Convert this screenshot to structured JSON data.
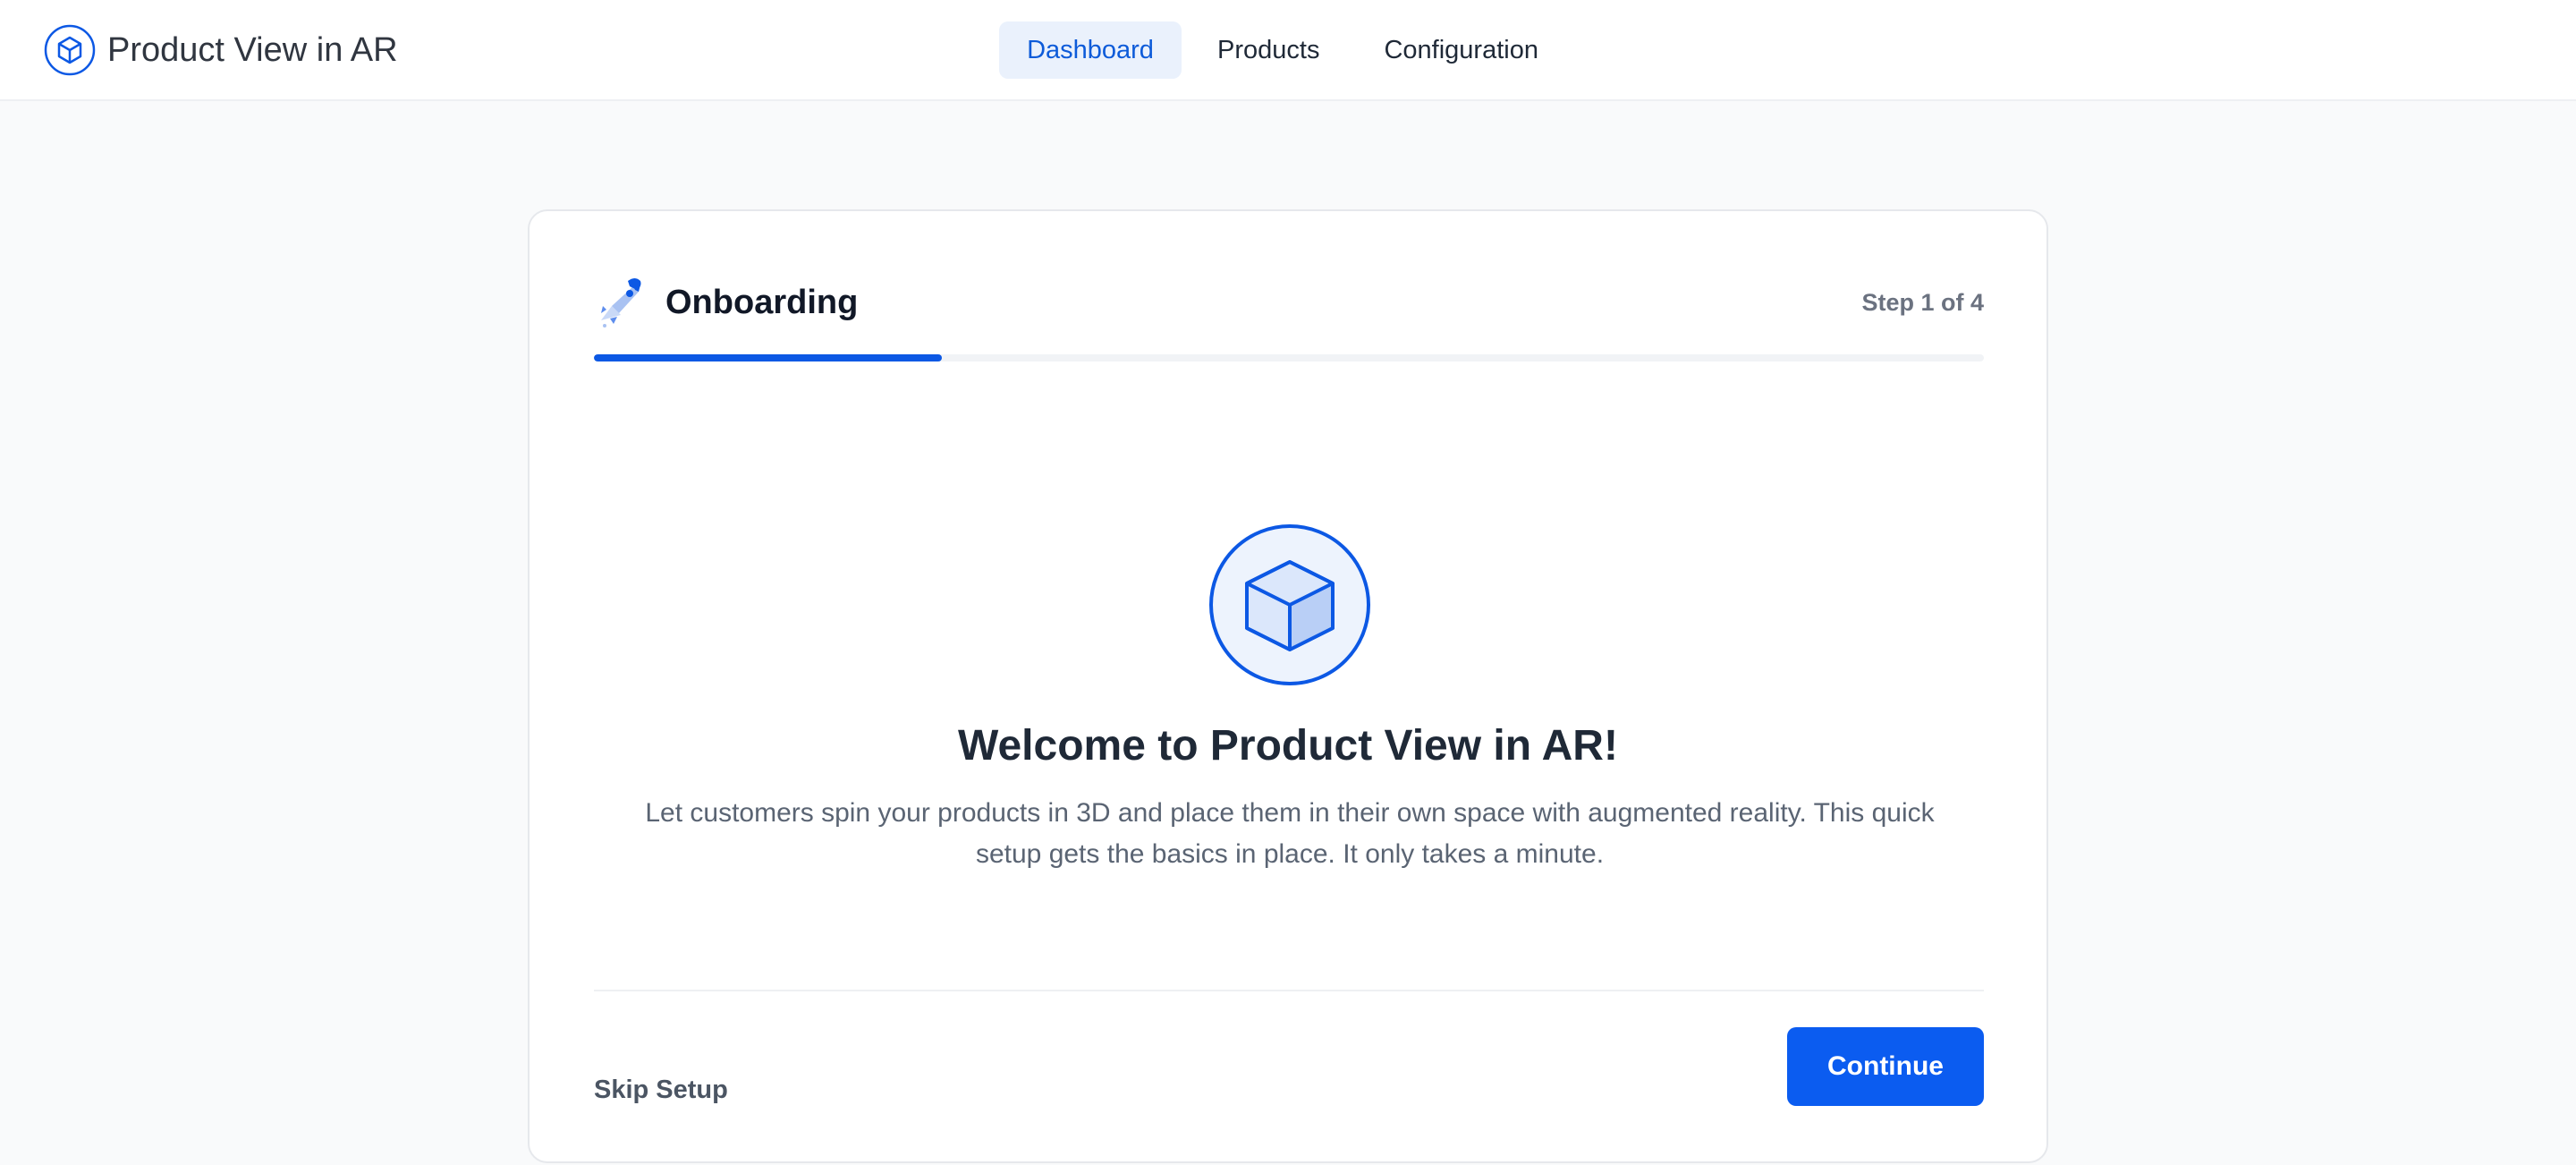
{
  "app": {
    "title": "Product View in AR",
    "logo_icon": "cube-icon"
  },
  "nav": {
    "items": [
      {
        "label": "Dashboard",
        "active": true
      },
      {
        "label": "Products",
        "active": false
      },
      {
        "label": "Configuration",
        "active": false
      }
    ]
  },
  "onboarding": {
    "header_icon": "rocket-icon",
    "title": "Onboarding",
    "step_text": "Step 1 of 4",
    "progress_fraction": 0.25,
    "hero_icon": "cube-icon",
    "welcome_title": "Welcome to Product View in AR!",
    "welcome_description": "Let customers spin your products in 3D and place them in their own space with augmented reality. This quick setup gets the basics in place. It only takes a minute.",
    "skip_label": "Skip Setup",
    "continue_label": "Continue"
  },
  "colors": {
    "accent": "#0b5cf0",
    "nav_active_bg": "#eaf1fc",
    "nav_active_text": "#0d5bd9",
    "page_bg": "#f9fafb"
  }
}
